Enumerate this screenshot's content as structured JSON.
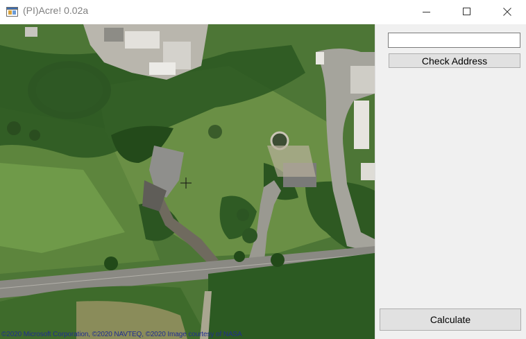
{
  "window": {
    "title": "(PI)Acre! 0.02a",
    "icon": "app-window-icon",
    "controls": [
      "minimize-icon",
      "maximize-icon",
      "close-icon"
    ]
  },
  "map": {
    "copyright": "©2020 Microsoft Corporation, ©2020 NAVTEQ, ©2020 Image courtesy of NASA",
    "cursor": "crosshair-icon"
  },
  "panel": {
    "address_value": "",
    "check_label": "Check Address",
    "calculate_label": "Calculate"
  }
}
